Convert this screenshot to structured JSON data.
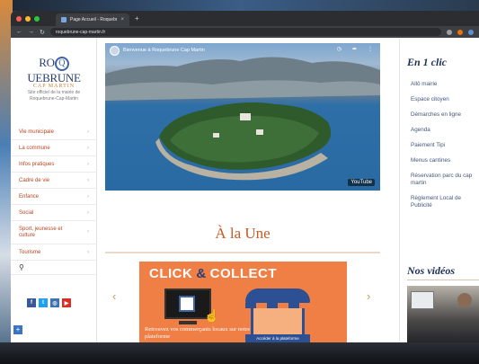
{
  "browser": {
    "tab_title": "Page Accueil - Roquebrune-Ca",
    "tab_close": "×",
    "new_tab": "+",
    "url": "roquebrune-cap-martin.fr",
    "nav": {
      "back": "←",
      "forward": "→",
      "reload": "↻"
    }
  },
  "sidebar": {
    "logo_main_left": "RO",
    "logo_main_q": "Q",
    "logo_main_right": "UEBRUNE",
    "logo_sub": "CAP MARTIN",
    "tagline": "Site officiel de la mairie de Roquebrune-Cap-Martin",
    "menu": [
      {
        "label": "Vie municipale"
      },
      {
        "label": "La commune"
      },
      {
        "label": "Infos pratiques"
      },
      {
        "label": "Cadre de vie"
      },
      {
        "label": "Enfance"
      },
      {
        "label": "Social"
      },
      {
        "label": "Sport, jeunesse et culture"
      },
      {
        "label": "Tourisme"
      }
    ],
    "chevron": "›",
    "search_icon": "⚲",
    "socials": [
      {
        "name": "facebook-icon",
        "glyph": "f",
        "color": "#3b5998"
      },
      {
        "name": "twitter-icon",
        "glyph": "t",
        "color": "#1da1f2"
      },
      {
        "name": "instagram-icon",
        "glyph": "◎",
        "color": "#3f72af"
      },
      {
        "name": "youtube-icon",
        "glyph": "▶",
        "color": "#d93025"
      }
    ],
    "zoom_plus": "+"
  },
  "video": {
    "title": "Bienvenue à Roquebrune Cap Martin",
    "youtube_badge": "YouTube",
    "tools": [
      "◷",
      "➦",
      "⋮"
    ]
  },
  "main": {
    "section_title": "À la Une",
    "banner": {
      "click": "CLICK",
      "amp": "&",
      "collect": "COLLECT",
      "text": "Retrouvez vos commerçants locaux sur notre plateforme",
      "button": "Accéder à la plateforme"
    },
    "prev_arrow": "‹",
    "next_arrow": "›"
  },
  "right": {
    "title": "En 1 clic",
    "links": [
      "Allô mairie",
      "Espace citoyen",
      "Démarches en ligne",
      "Agenda",
      "Paiement Tipi",
      "Menus cantines",
      "Réservation parc du cap martin",
      "Règlement Local de Publicité"
    ],
    "videos_title": "Nos vidéos"
  },
  "colors": {
    "accent": "#c55a24",
    "navy": "#1e2e55",
    "banner_orange": "#f07f46"
  }
}
